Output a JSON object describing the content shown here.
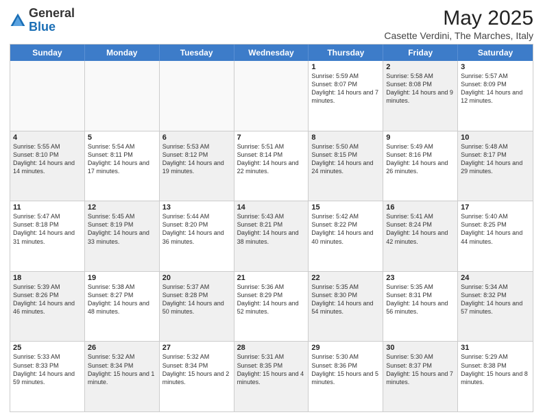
{
  "header": {
    "logo_general": "General",
    "logo_blue": "Blue",
    "main_title": "May 2025",
    "subtitle": "Casette Verdini, The Marches, Italy"
  },
  "calendar": {
    "days": [
      "Sunday",
      "Monday",
      "Tuesday",
      "Wednesday",
      "Thursday",
      "Friday",
      "Saturday"
    ],
    "rows": [
      [
        {
          "day": "",
          "text": "",
          "empty": true
        },
        {
          "day": "",
          "text": "",
          "empty": true
        },
        {
          "day": "",
          "text": "",
          "empty": true
        },
        {
          "day": "",
          "text": "",
          "empty": true
        },
        {
          "day": "1",
          "text": "Sunrise: 5:59 AM\nSunset: 8:07 PM\nDaylight: 14 hours\nand 7 minutes.",
          "shaded": false
        },
        {
          "day": "2",
          "text": "Sunrise: 5:58 AM\nSunset: 8:08 PM\nDaylight: 14 hours\nand 9 minutes.",
          "shaded": true
        },
        {
          "day": "3",
          "text": "Sunrise: 5:57 AM\nSunset: 8:09 PM\nDaylight: 14 hours\nand 12 minutes.",
          "shaded": false
        }
      ],
      [
        {
          "day": "4",
          "text": "Sunrise: 5:55 AM\nSunset: 8:10 PM\nDaylight: 14 hours\nand 14 minutes.",
          "shaded": true
        },
        {
          "day": "5",
          "text": "Sunrise: 5:54 AM\nSunset: 8:11 PM\nDaylight: 14 hours\nand 17 minutes.",
          "shaded": false
        },
        {
          "day": "6",
          "text": "Sunrise: 5:53 AM\nSunset: 8:12 PM\nDaylight: 14 hours\nand 19 minutes.",
          "shaded": true
        },
        {
          "day": "7",
          "text": "Sunrise: 5:51 AM\nSunset: 8:14 PM\nDaylight: 14 hours\nand 22 minutes.",
          "shaded": false
        },
        {
          "day": "8",
          "text": "Sunrise: 5:50 AM\nSunset: 8:15 PM\nDaylight: 14 hours\nand 24 minutes.",
          "shaded": true
        },
        {
          "day": "9",
          "text": "Sunrise: 5:49 AM\nSunset: 8:16 PM\nDaylight: 14 hours\nand 26 minutes.",
          "shaded": false
        },
        {
          "day": "10",
          "text": "Sunrise: 5:48 AM\nSunset: 8:17 PM\nDaylight: 14 hours\nand 29 minutes.",
          "shaded": true
        }
      ],
      [
        {
          "day": "11",
          "text": "Sunrise: 5:47 AM\nSunset: 8:18 PM\nDaylight: 14 hours\nand 31 minutes.",
          "shaded": false
        },
        {
          "day": "12",
          "text": "Sunrise: 5:45 AM\nSunset: 8:19 PM\nDaylight: 14 hours\nand 33 minutes.",
          "shaded": true
        },
        {
          "day": "13",
          "text": "Sunrise: 5:44 AM\nSunset: 8:20 PM\nDaylight: 14 hours\nand 36 minutes.",
          "shaded": false
        },
        {
          "day": "14",
          "text": "Sunrise: 5:43 AM\nSunset: 8:21 PM\nDaylight: 14 hours\nand 38 minutes.",
          "shaded": true
        },
        {
          "day": "15",
          "text": "Sunrise: 5:42 AM\nSunset: 8:22 PM\nDaylight: 14 hours\nand 40 minutes.",
          "shaded": false
        },
        {
          "day": "16",
          "text": "Sunrise: 5:41 AM\nSunset: 8:24 PM\nDaylight: 14 hours\nand 42 minutes.",
          "shaded": true
        },
        {
          "day": "17",
          "text": "Sunrise: 5:40 AM\nSunset: 8:25 PM\nDaylight: 14 hours\nand 44 minutes.",
          "shaded": false
        }
      ],
      [
        {
          "day": "18",
          "text": "Sunrise: 5:39 AM\nSunset: 8:26 PM\nDaylight: 14 hours\nand 46 minutes.",
          "shaded": true
        },
        {
          "day": "19",
          "text": "Sunrise: 5:38 AM\nSunset: 8:27 PM\nDaylight: 14 hours\nand 48 minutes.",
          "shaded": false
        },
        {
          "day": "20",
          "text": "Sunrise: 5:37 AM\nSunset: 8:28 PM\nDaylight: 14 hours\nand 50 minutes.",
          "shaded": true
        },
        {
          "day": "21",
          "text": "Sunrise: 5:36 AM\nSunset: 8:29 PM\nDaylight: 14 hours\nand 52 minutes.",
          "shaded": false
        },
        {
          "day": "22",
          "text": "Sunrise: 5:35 AM\nSunset: 8:30 PM\nDaylight: 14 hours\nand 54 minutes.",
          "shaded": true
        },
        {
          "day": "23",
          "text": "Sunrise: 5:35 AM\nSunset: 8:31 PM\nDaylight: 14 hours\nand 56 minutes.",
          "shaded": false
        },
        {
          "day": "24",
          "text": "Sunrise: 5:34 AM\nSunset: 8:32 PM\nDaylight: 14 hours\nand 57 minutes.",
          "shaded": true
        }
      ],
      [
        {
          "day": "25",
          "text": "Sunrise: 5:33 AM\nSunset: 8:33 PM\nDaylight: 14 hours\nand 59 minutes.",
          "shaded": false
        },
        {
          "day": "26",
          "text": "Sunrise: 5:32 AM\nSunset: 8:34 PM\nDaylight: 15 hours\nand 1 minute.",
          "shaded": true
        },
        {
          "day": "27",
          "text": "Sunrise: 5:32 AM\nSunset: 8:34 PM\nDaylight: 15 hours\nand 2 minutes.",
          "shaded": false
        },
        {
          "day": "28",
          "text": "Sunrise: 5:31 AM\nSunset: 8:35 PM\nDaylight: 15 hours\nand 4 minutes.",
          "shaded": true
        },
        {
          "day": "29",
          "text": "Sunrise: 5:30 AM\nSunset: 8:36 PM\nDaylight: 15 hours\nand 5 minutes.",
          "shaded": false
        },
        {
          "day": "30",
          "text": "Sunrise: 5:30 AM\nSunset: 8:37 PM\nDaylight: 15 hours\nand 7 minutes.",
          "shaded": true
        },
        {
          "day": "31",
          "text": "Sunrise: 5:29 AM\nSunset: 8:38 PM\nDaylight: 15 hours\nand 8 minutes.",
          "shaded": false
        }
      ]
    ]
  }
}
